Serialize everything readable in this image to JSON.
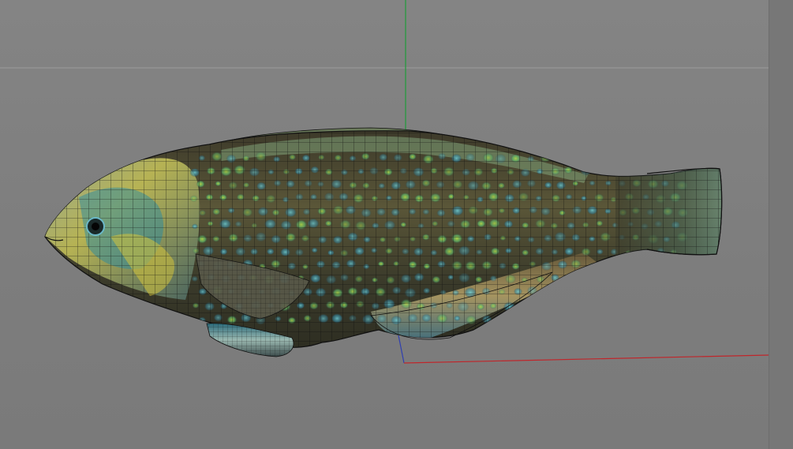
{
  "viewport": {
    "background": "#808080",
    "grid_line_color": "#9c9c9c",
    "x_axis_color": "#c0262b",
    "y_axis_color": "#1f9b3a",
    "z_axis_color": "#2f3fb0"
  },
  "model": {
    "name": "fish",
    "body_base_color": "#4a4a32",
    "scale_spot_colors": [
      "#8fcf3c",
      "#2fb0c0",
      "#c7c23a",
      "#6fc56a"
    ],
    "wireframe_color": "#101010"
  },
  "right_panel": {
    "background": "#777777"
  }
}
